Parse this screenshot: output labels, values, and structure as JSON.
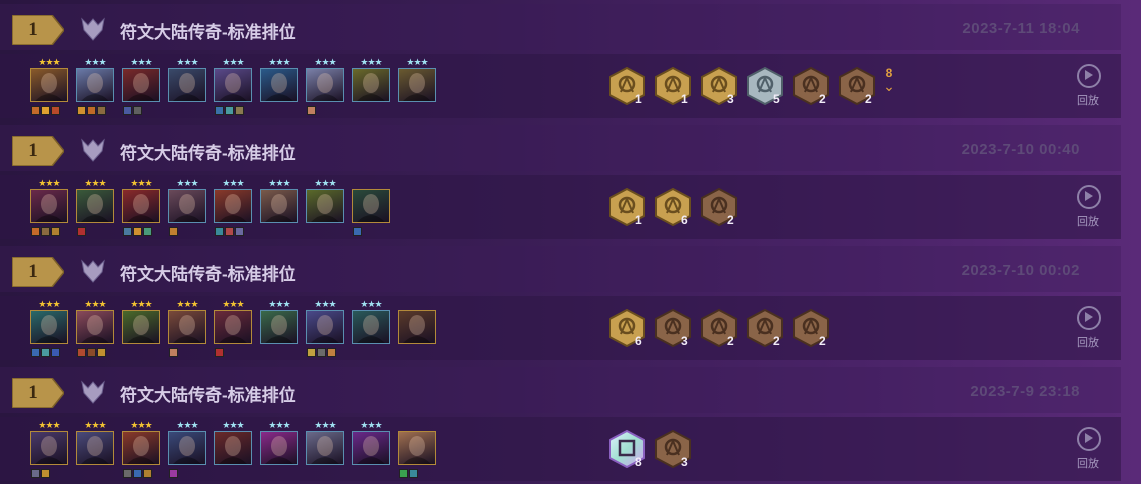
{
  "replay_label": "回放",
  "matches": [
    {
      "rank": "1",
      "mode": "符文大陆传奇-标准排位",
      "date": "2023-7-11 18:04",
      "units": [
        {
          "stars": "gold",
          "icon": "champion-portrait",
          "color": "#8a5a2a",
          "items": [
            "#c46a2a",
            "#e0a030",
            "#b84a2a"
          ]
        },
        {
          "stars": "silver",
          "icon": "champion-portrait",
          "color": "#6a7aa8",
          "items": [
            "#d09030",
            "#c06a28",
            "#8a6a40"
          ]
        },
        {
          "stars": "silver",
          "icon": "champion-portrait",
          "color": "#7a2a2a",
          "items": [
            "#4a5aa0",
            "#606060"
          ]
        },
        {
          "stars": "silver",
          "icon": "champion-portrait",
          "color": "#3a4a6a",
          "items": []
        },
        {
          "stars": "silver",
          "icon": "champion-portrait",
          "color": "#5a4a8a",
          "items": [
            "#3a70a8",
            "#4a9aa0",
            "#8a7a50"
          ]
        },
        {
          "stars": "silver",
          "icon": "champion-portrait",
          "color": "#2a5a8a",
          "items": []
        },
        {
          "stars": "silver",
          "icon": "champion-portrait",
          "color": "#7a80a8",
          "items": [
            "#c08060"
          ]
        },
        {
          "stars": "silver",
          "icon": "champion-portrait",
          "color": "#6a6a2a",
          "items": []
        },
        {
          "stars": "silver",
          "icon": "champion-portrait",
          "color": "#6a5a30",
          "items": []
        }
      ],
      "traits": [
        {
          "count": "1",
          "tier": "gold",
          "icon": "trait-emblem-icon"
        },
        {
          "count": "1",
          "tier": "gold",
          "icon": "trait-emblem-icon"
        },
        {
          "count": "3",
          "tier": "gold",
          "icon": "trait-emblem-icon"
        },
        {
          "count": "5",
          "tier": "silver",
          "icon": "trait-emblem-icon"
        },
        {
          "count": "2",
          "tier": "bronze",
          "icon": "trait-emblem-icon"
        },
        {
          "count": "2",
          "tier": "bronze",
          "icon": "trait-emblem-icon"
        }
      ],
      "more": "8"
    },
    {
      "rank": "1",
      "mode": "符文大陆传奇-标准排位",
      "date": "2023-7-10 00:40",
      "units": [
        {
          "stars": "gold",
          "icon": "champion-portrait",
          "color": "#6a2a4a",
          "items": [
            "#c46a2a",
            "#8a6a40",
            "#b08030"
          ]
        },
        {
          "stars": "gold",
          "icon": "champion-portrait",
          "color": "#3a5a3a",
          "items": [
            "#b03030"
          ]
        },
        {
          "stars": "gold",
          "icon": "champion-portrait",
          "color": "#8a2a2a",
          "items": [
            "#4a7aa0",
            "#d09030",
            "#4a9a7a"
          ]
        },
        {
          "stars": "silver",
          "icon": "champion-portrait",
          "color": "#6a4a5a",
          "items": [
            "#c08030"
          ]
        },
        {
          "stars": "silver",
          "icon": "champion-portrait",
          "color": "#8a3a2a",
          "items": [
            "#3a8a9a",
            "#b04a4a",
            "#6a6aa0"
          ]
        },
        {
          "stars": "silver",
          "icon": "champion-portrait",
          "color": "#7a5a4a",
          "items": []
        },
        {
          "stars": "silver",
          "icon": "champion-portrait",
          "color": "#5a6a2a",
          "items": []
        },
        {
          "stars": "none",
          "icon": "champion-portrait",
          "color": "#2a4a3a",
          "items": [
            "#3a6ab0"
          ]
        }
      ],
      "traits": [
        {
          "count": "1",
          "tier": "gold",
          "icon": "trait-emblem-icon"
        },
        {
          "count": "6",
          "tier": "gold",
          "icon": "trait-emblem-icon"
        },
        {
          "count": "2",
          "tier": "bronze",
          "icon": "trait-emblem-icon"
        }
      ],
      "more": ""
    },
    {
      "rank": "1",
      "mode": "符文大陆传奇-标准排位",
      "date": "2023-7-10 00:02",
      "units": [
        {
          "stars": "gold",
          "icon": "champion-portrait",
          "color": "#2a6a6a",
          "items": [
            "#3a6ab0",
            "#4a9aa0",
            "#3a5ab0"
          ]
        },
        {
          "stars": "gold",
          "icon": "champion-portrait",
          "color": "#8a4a5a",
          "items": [
            "#b04a30",
            "#8a4a2a",
            "#c09030"
          ]
        },
        {
          "stars": "gold",
          "icon": "champion-portrait",
          "color": "#4a6a2a",
          "items": []
        },
        {
          "stars": "gold",
          "icon": "champion-portrait",
          "color": "#7a4a3a",
          "items": [
            "#c08060"
          ]
        },
        {
          "stars": "gold",
          "icon": "champion-portrait",
          "color": "#6a2a3a",
          "items": [
            "#b03030"
          ]
        },
        {
          "stars": "silver",
          "icon": "champion-portrait",
          "color": "#3a6a4a",
          "items": []
        },
        {
          "stars": "silver",
          "icon": "champion-portrait",
          "color": "#4a4a8a",
          "items": [
            "#c0a040",
            "#6a6a6a",
            "#c08040"
          ]
        },
        {
          "stars": "silver",
          "icon": "champion-portrait",
          "color": "#2a5a5a",
          "items": []
        },
        {
          "stars": "none",
          "icon": "champion-portrait",
          "color": "#5a3a2a",
          "items": []
        }
      ],
      "traits": [
        {
          "count": "6",
          "tier": "gold",
          "icon": "trait-emblem-icon"
        },
        {
          "count": "3",
          "tier": "bronze",
          "icon": "trait-emblem-icon"
        },
        {
          "count": "2",
          "tier": "bronze",
          "icon": "trait-emblem-icon"
        },
        {
          "count": "2",
          "tier": "bronze",
          "icon": "trait-emblem-icon"
        },
        {
          "count": "2",
          "tier": "bronze",
          "icon": "trait-emblem-icon"
        }
      ],
      "more": ""
    },
    {
      "rank": "1",
      "mode": "符文大陆传奇-标准排位",
      "date": "2023-7-9 23:18",
      "units": [
        {
          "stars": "gold",
          "icon": "champion-portrait",
          "color": "#4a3a6a",
          "items": [
            "#6a6a8a",
            "#c09030"
          ]
        },
        {
          "stars": "gold",
          "icon": "champion-portrait",
          "color": "#4a4a7a",
          "items": []
        },
        {
          "stars": "gold",
          "icon": "champion-portrait",
          "color": "#8a3a2a",
          "items": [
            "#6a6a6a",
            "#3a6ab0",
            "#b08030"
          ]
        },
        {
          "stars": "silver",
          "icon": "champion-portrait",
          "color": "#3a4a7a",
          "items": [
            "#9a3aa0"
          ]
        },
        {
          "stars": "silver",
          "icon": "champion-portrait",
          "color": "#6a2a2a",
          "items": []
        },
        {
          "stars": "silver",
          "icon": "champion-portrait",
          "color": "#8a2a8a",
          "items": []
        },
        {
          "stars": "silver",
          "icon": "champion-portrait",
          "color": "#6a6a8a",
          "items": []
        },
        {
          "stars": "silver",
          "icon": "champion-portrait",
          "color": "#6a2a8a",
          "items": []
        },
        {
          "stars": "none",
          "icon": "champion-portrait",
          "color": "#a07050",
          "items": [
            "#3aa050",
            "#3a8a9a"
          ]
        }
      ],
      "traits": [
        {
          "count": "8",
          "tier": "prismatic",
          "icon": "trait-emblem-icon"
        },
        {
          "count": "3",
          "tier": "bronze",
          "icon": "trait-emblem-icon"
        }
      ],
      "more": ""
    }
  ]
}
